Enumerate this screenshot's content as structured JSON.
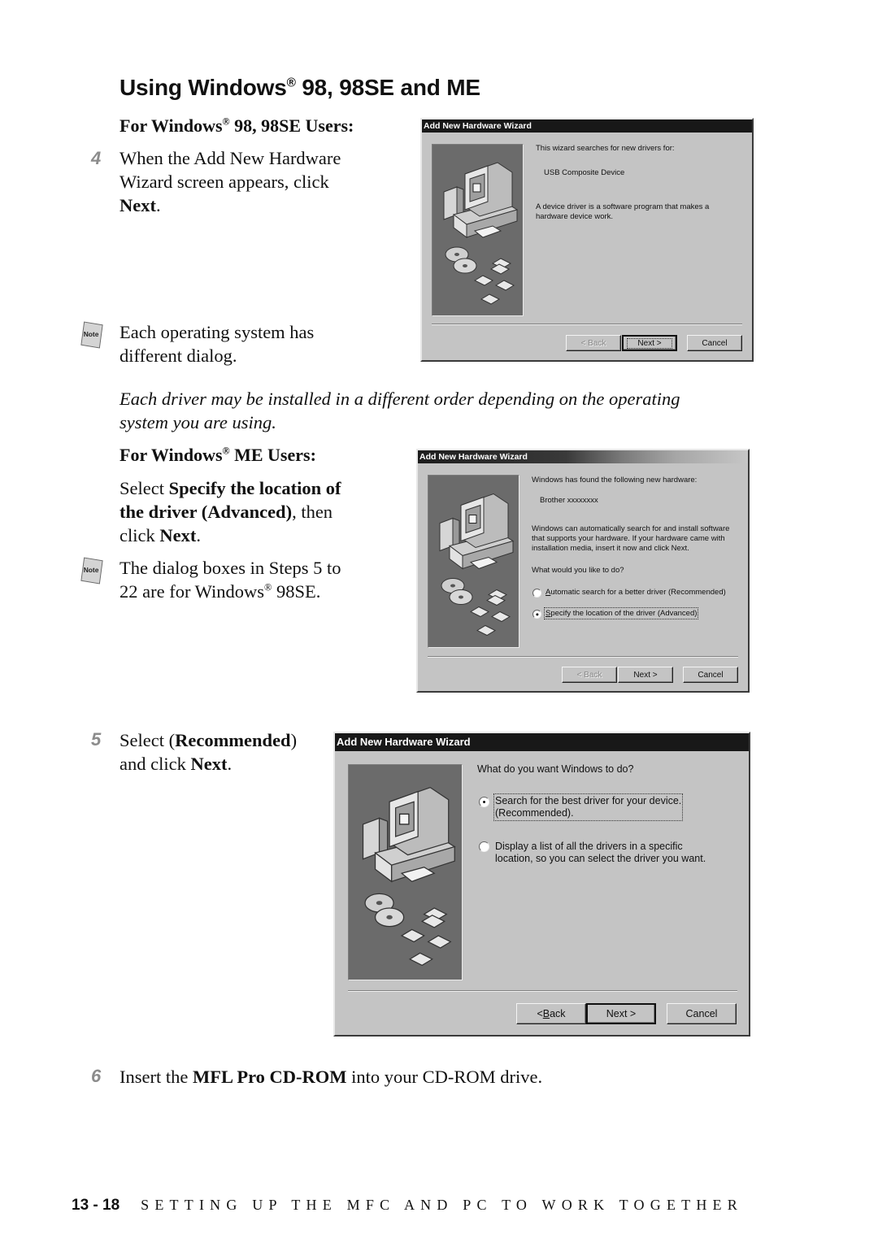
{
  "page": {
    "heading": {
      "pre": "Using Windows",
      "reg": "®",
      "post": " 98, 98SE and ME"
    },
    "section_98": {
      "pre": "For Windows",
      "reg": "®",
      "post": " 98, 98SE Users:"
    },
    "step4": {
      "number": "4",
      "line1": "When the Add New Hardware",
      "line2": "Wizard screen appears, click",
      "line3_bold": "Next",
      "line3_end": "."
    },
    "note1": {
      "icon_label": "Note",
      "line1": "Each operating system has",
      "line2": "different dialog."
    },
    "italic_note": {
      "line1": "Each driver may be installed in a different order depending on the operating",
      "line2": "system you are using."
    },
    "section_me": {
      "pre": "For Windows",
      "reg": "®",
      "post": " ME Users:"
    },
    "me_instruction": {
      "l1_pre": "Select ",
      "l1_bold": "Specify the location of",
      "l2_bold": "the driver (Advanced)",
      "l2_end": ", then",
      "l3_pre": "click ",
      "l3_bold": "Next",
      "l3_end": "."
    },
    "note2": {
      "icon_label": "Note",
      "line1": "The dialog boxes in Steps 5 to",
      "line2_pre": "22 are for Windows",
      "line2_reg": "®",
      "line2_post": " 98SE."
    },
    "step5": {
      "number": "5",
      "l1_pre": "Select (",
      "l1_bold": "Recommended",
      "l1_end": ")",
      "l2_pre": "and click ",
      "l2_bold": "Next",
      "l2_end": "."
    },
    "step6": {
      "number": "6",
      "pre": "Insert the ",
      "bold": "MFL Pro CD-ROM",
      "post": " into your CD-ROM drive."
    },
    "footer": {
      "page_number": "13 - 18",
      "chapter_title": "SETTING UP THE MFC AND PC TO WORK TOGETHER"
    }
  },
  "dialogs": [
    {
      "title": "Add New Hardware Wizard",
      "illustration": "computer-with-disks",
      "intro": "This wizard searches for new drivers for:",
      "device": "USB Composite Device",
      "desc_line1": "A device driver is a software program that makes a",
      "desc_line2": "hardware device work.",
      "buttons": {
        "back": "< Back",
        "back_accel": "B",
        "next": "Next >",
        "cancel": "Cancel"
      },
      "back_enabled": false,
      "default_button": "next"
    },
    {
      "title": "Add New Hardware Wizard",
      "illustration": "computer-with-disks",
      "intro": "Windows has found the following new hardware:",
      "device": "Brother xxxxxxxx",
      "desc_line1": "Windows can automatically search for and install software",
      "desc_line2": "that supports your hardware. If your hardware came with",
      "desc_line3": "installation media, insert it now and click Next.",
      "question": "What would you like to do?",
      "options": [
        {
          "accel": "A",
          "label": "utomatic search for a better driver (Recommended)",
          "selected": false
        },
        {
          "accel": "S",
          "label": "pecify the location of the driver (Advanced)",
          "selected": true
        }
      ],
      "buttons": {
        "back": "< Back",
        "back_accel": "B",
        "next": "Next >",
        "cancel": "Cancel"
      },
      "back_enabled": false,
      "default_button": "next"
    },
    {
      "title": "Add New Hardware Wizard",
      "illustration": "computer-with-disks",
      "question": "What do you want Windows to do?",
      "options": [
        {
          "line1": "Search for the best driver for your device.",
          "line2": "(Recommended).",
          "selected": true
        },
        {
          "line1": "Display a list of all the drivers in a specific",
          "line2": "location, so you can select the driver you want.",
          "selected": false
        }
      ],
      "buttons": {
        "back_pre": "< ",
        "back_accel": "B",
        "back_post": "ack",
        "next": "Next >",
        "cancel": "Cancel"
      },
      "back_enabled": true,
      "default_button": "next"
    }
  ]
}
